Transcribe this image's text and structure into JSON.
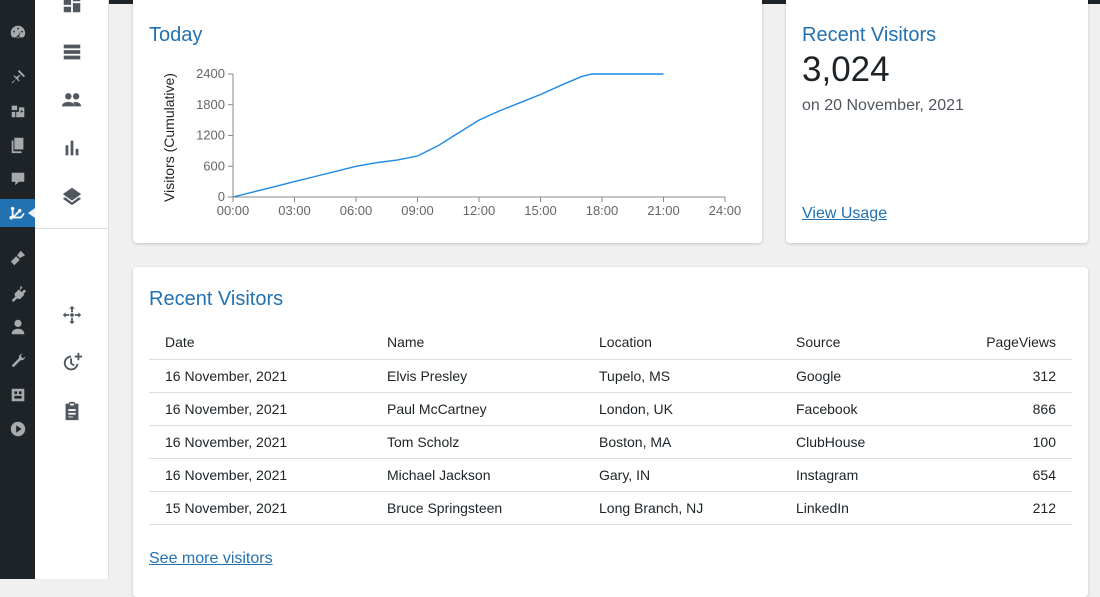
{
  "admin_menu": {
    "items": [
      "dashboard-icon",
      "posts-icon",
      "media-icon",
      "pages-icon",
      "comments-icon",
      "analytics-icon",
      "appearance-icon",
      "plugins-icon",
      "users-icon",
      "tools-icon",
      "settings-icon",
      "video-icon"
    ],
    "active_index": 5
  },
  "submenu": {
    "items": [
      "dashboard-layout-icon",
      "list-icon",
      "people-icon",
      "bar-chart-icon",
      "layers-icon",
      "move-icon",
      "schedule-add-icon",
      "clipboard-icon"
    ]
  },
  "today_card": {
    "title": "Today",
    "chart_data": {
      "type": "line",
      "title": "",
      "ylabel": "Visitors (Cumulative)",
      "xlabel": "",
      "x_ticks": [
        "00:00",
        "03:00",
        "06:00",
        "09:00",
        "12:00",
        "15:00",
        "18:00",
        "21:00",
        "24:00"
      ],
      "y_ticks": [
        "0",
        "600",
        "1200",
        "1800",
        "2400"
      ],
      "xlim": [
        0,
        24
      ],
      "ylim": [
        0,
        2400
      ],
      "series": [
        {
          "color": "#1e88e5",
          "x": [
            0,
            1,
            2,
            3,
            4,
            5,
            6,
            7,
            8,
            9,
            10,
            11,
            12,
            13,
            14,
            15,
            16,
            17,
            17.5,
            18,
            19,
            20,
            21
          ],
          "y": [
            0,
            100,
            200,
            300,
            400,
            500,
            600,
            670,
            720,
            800,
            1000,
            1250,
            1500,
            1680,
            1840,
            2000,
            2180,
            2350,
            2400,
            2400,
            2400,
            2400,
            2400
          ]
        }
      ]
    }
  },
  "recent_card": {
    "title": "Recent Visitors",
    "count": "3,024",
    "date": "on 20 November, 2021",
    "link": "View Usage"
  },
  "visitors_table": {
    "title": "Recent Visitors",
    "columns": [
      "Date",
      "Name",
      "Location",
      "Source",
      "PageViews"
    ],
    "rows": [
      [
        "16 November, 2021",
        "Elvis Presley",
        "Tupelo, MS",
        "Google",
        "312"
      ],
      [
        "16 November, 2021",
        "Paul McCartney",
        "London, UK",
        "Facebook",
        "866"
      ],
      [
        "16 November, 2021",
        "Tom Scholz",
        "Boston, MA",
        "ClubHouse",
        "100"
      ],
      [
        "16 November, 2021",
        "Michael Jackson",
        "Gary, IN",
        "Instagram",
        "654"
      ],
      [
        "15 November, 2021",
        "Bruce Springsteen",
        "Long Branch, NJ",
        "LinkedIn",
        "212"
      ]
    ],
    "link": "See more visitors"
  }
}
